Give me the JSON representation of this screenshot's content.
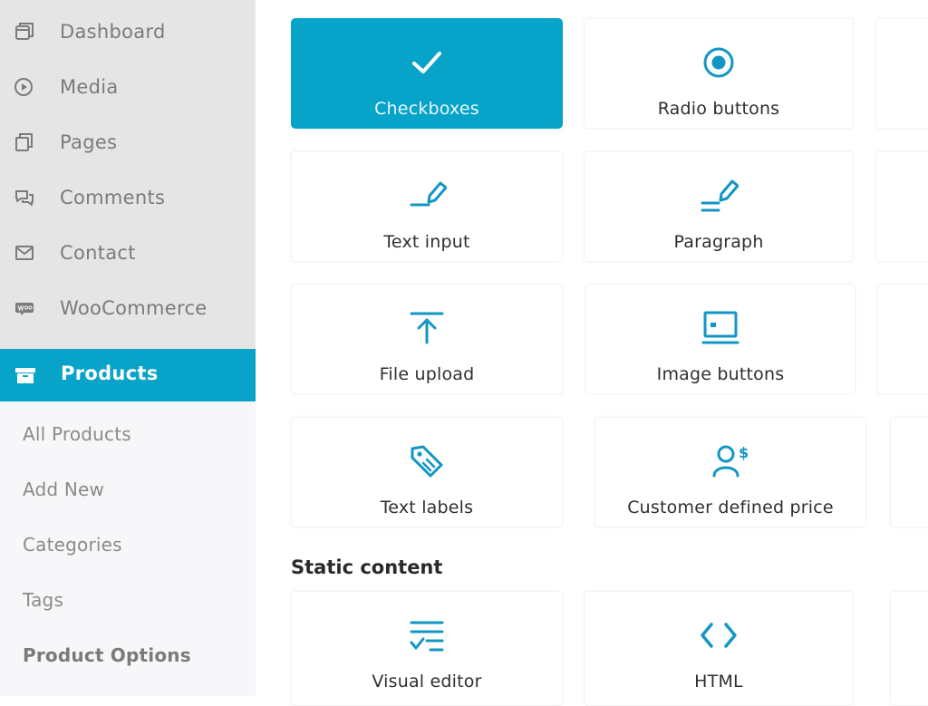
{
  "sidebar": {
    "items": [
      {
        "label": "Dashboard",
        "icon": "dashboard-icon"
      },
      {
        "label": "Media",
        "icon": "media-icon"
      },
      {
        "label": "Pages",
        "icon": "pages-icon"
      },
      {
        "label": "Comments",
        "icon": "comments-icon"
      },
      {
        "label": "Contact",
        "icon": "contact-icon"
      },
      {
        "label": "WooCommerce",
        "icon": "woocommerce-icon"
      }
    ],
    "active": {
      "label": "Products",
      "icon": "products-icon"
    },
    "submenu": [
      "All Products",
      "Add New",
      "Categories",
      "Tags",
      "Product Options"
    ]
  },
  "fields": {
    "options": [
      {
        "label": "Checkboxes",
        "icon": "checkmark-icon",
        "selected": true
      },
      {
        "label": "Radio buttons",
        "icon": "radio-button-icon"
      },
      {
        "label": "Text input",
        "icon": "text-input-icon"
      },
      {
        "label": "Paragraph",
        "icon": "paragraph-icon"
      },
      {
        "label": "File upload",
        "icon": "file-upload-icon"
      },
      {
        "label": "Image buttons",
        "icon": "image-buttons-icon"
      },
      {
        "label": "Text labels",
        "icon": "tag-icon"
      },
      {
        "label": "Customer defined price",
        "icon": "customer-price-icon"
      }
    ],
    "static_title": "Static content",
    "static": [
      {
        "label": "Visual editor",
        "icon": "visual-editor-icon"
      },
      {
        "label": "HTML",
        "icon": "html-code-icon"
      }
    ]
  },
  "colors": {
    "accent": "#07a3c8",
    "sidebar_bg": "#e5e5e5",
    "submenu_bg": "#f7f7f9",
    "icon_blue": "#1296c4"
  }
}
